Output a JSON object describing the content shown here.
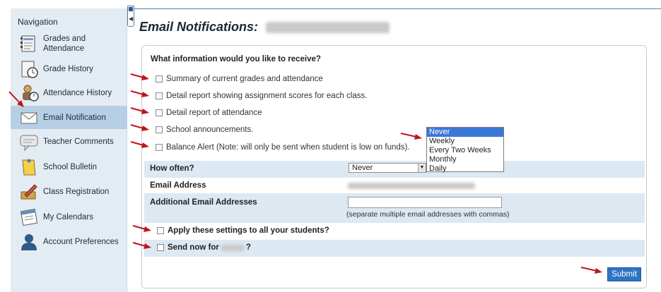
{
  "navigation": {
    "title": "Navigation",
    "items": [
      {
        "label_line1": "Grades and",
        "label_line2": "Attendance",
        "icon": "grades-book-icon"
      },
      {
        "label_line1": "Grade History",
        "label_line2": "",
        "icon": "grade-history-icon"
      },
      {
        "label_line1": "Attendance History",
        "label_line2": "",
        "icon": "attendance-history-icon"
      },
      {
        "label_line1": "Email Notification",
        "label_line2": "",
        "icon": "envelope-icon"
      },
      {
        "label_line1": "Teacher Comments",
        "label_line2": "",
        "icon": "speech-bubble-icon"
      },
      {
        "label_line1": "School Bulletin",
        "label_line2": "",
        "icon": "bulletin-icon"
      },
      {
        "label_line1": "Class Registration",
        "label_line2": "",
        "icon": "registration-icon"
      },
      {
        "label_line1": "My Calendars",
        "label_line2": "",
        "icon": "calendar-icon"
      },
      {
        "label_line1": "Account Preferences",
        "label_line2": "",
        "icon": "user-account-icon"
      }
    ]
  },
  "page": {
    "title": "Email Notifications:"
  },
  "form": {
    "question": "What information would you like to receive?",
    "options": [
      "Summary of current grades and attendance",
      "Detail report showing assignment scores for each class.",
      "Detail report of attendance",
      "School announcements.",
      "Balance Alert (Note: will only be sent when student is low on funds)."
    ],
    "how_often_label": "How often?",
    "how_often_value": "Never",
    "frequency_options": [
      "Never",
      "Weekly",
      "Every Two Weeks",
      "Monthly",
      "Daily"
    ],
    "email_label": "Email Address",
    "additional_label": "Additional Email Addresses",
    "additional_value": "",
    "hint": "(separate multiple email addresses with commas)",
    "apply_all": "Apply these settings to all your students?",
    "send_now_prefix": "Send now for",
    "send_now_suffix": "?",
    "submit_label": "Submit"
  },
  "colors": {
    "sidebar_bg": "#e4ecf3",
    "active_item": "#b7cfe4",
    "band": "#dce8f2",
    "submit": "#2f74c2",
    "arrow": "#c0141c",
    "selected_option": "#3a78d6"
  }
}
